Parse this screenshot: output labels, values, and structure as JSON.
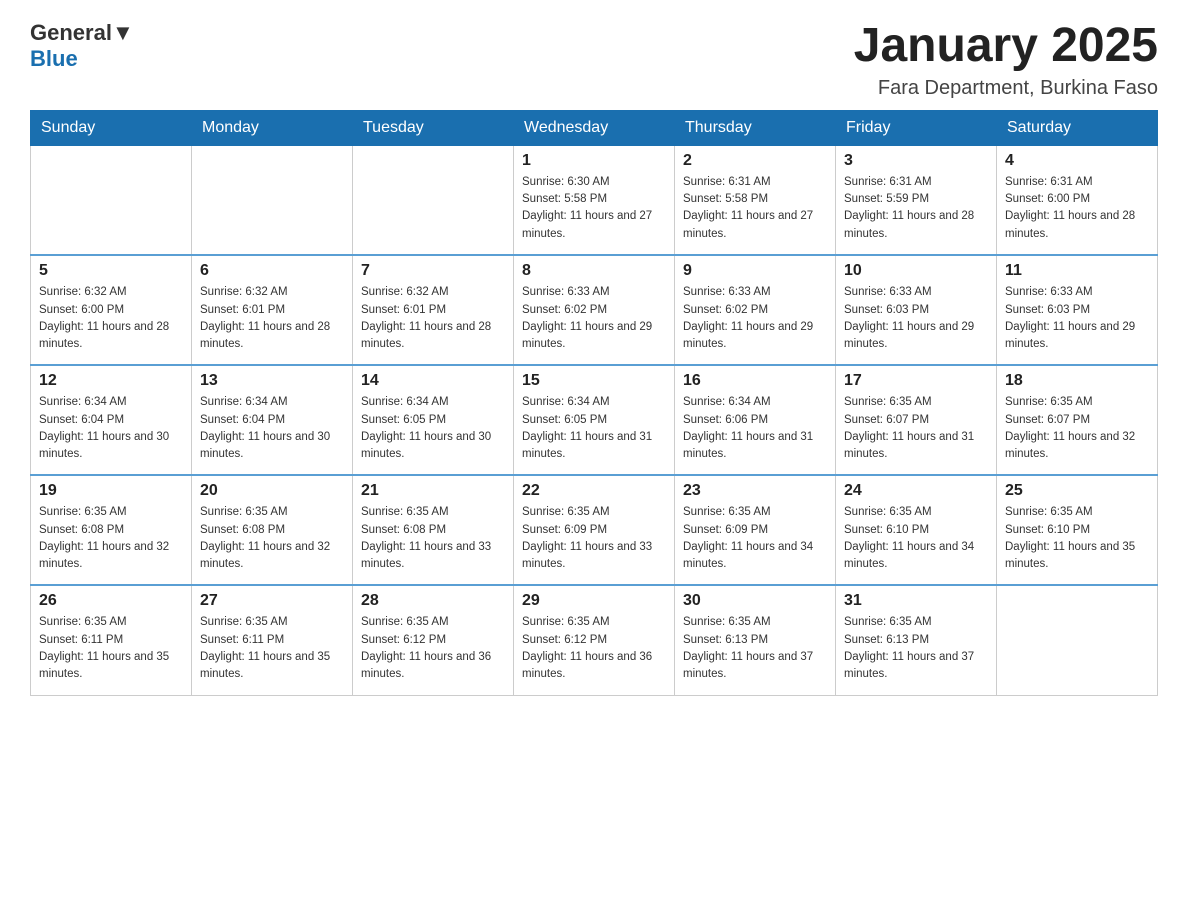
{
  "header": {
    "logo_text_general": "General",
    "logo_text_blue": "Blue",
    "title": "January 2025",
    "subtitle": "Fara Department, Burkina Faso"
  },
  "days_of_week": [
    "Sunday",
    "Monday",
    "Tuesday",
    "Wednesday",
    "Thursday",
    "Friday",
    "Saturday"
  ],
  "weeks": [
    {
      "days": [
        {
          "number": "",
          "info": ""
        },
        {
          "number": "",
          "info": ""
        },
        {
          "number": "",
          "info": ""
        },
        {
          "number": "1",
          "info": "Sunrise: 6:30 AM\nSunset: 5:58 PM\nDaylight: 11 hours and 27 minutes."
        },
        {
          "number": "2",
          "info": "Sunrise: 6:31 AM\nSunset: 5:58 PM\nDaylight: 11 hours and 27 minutes."
        },
        {
          "number": "3",
          "info": "Sunrise: 6:31 AM\nSunset: 5:59 PM\nDaylight: 11 hours and 28 minutes."
        },
        {
          "number": "4",
          "info": "Sunrise: 6:31 AM\nSunset: 6:00 PM\nDaylight: 11 hours and 28 minutes."
        }
      ]
    },
    {
      "days": [
        {
          "number": "5",
          "info": "Sunrise: 6:32 AM\nSunset: 6:00 PM\nDaylight: 11 hours and 28 minutes."
        },
        {
          "number": "6",
          "info": "Sunrise: 6:32 AM\nSunset: 6:01 PM\nDaylight: 11 hours and 28 minutes."
        },
        {
          "number": "7",
          "info": "Sunrise: 6:32 AM\nSunset: 6:01 PM\nDaylight: 11 hours and 28 minutes."
        },
        {
          "number": "8",
          "info": "Sunrise: 6:33 AM\nSunset: 6:02 PM\nDaylight: 11 hours and 29 minutes."
        },
        {
          "number": "9",
          "info": "Sunrise: 6:33 AM\nSunset: 6:02 PM\nDaylight: 11 hours and 29 minutes."
        },
        {
          "number": "10",
          "info": "Sunrise: 6:33 AM\nSunset: 6:03 PM\nDaylight: 11 hours and 29 minutes."
        },
        {
          "number": "11",
          "info": "Sunrise: 6:33 AM\nSunset: 6:03 PM\nDaylight: 11 hours and 29 minutes."
        }
      ]
    },
    {
      "days": [
        {
          "number": "12",
          "info": "Sunrise: 6:34 AM\nSunset: 6:04 PM\nDaylight: 11 hours and 30 minutes."
        },
        {
          "number": "13",
          "info": "Sunrise: 6:34 AM\nSunset: 6:04 PM\nDaylight: 11 hours and 30 minutes."
        },
        {
          "number": "14",
          "info": "Sunrise: 6:34 AM\nSunset: 6:05 PM\nDaylight: 11 hours and 30 minutes."
        },
        {
          "number": "15",
          "info": "Sunrise: 6:34 AM\nSunset: 6:05 PM\nDaylight: 11 hours and 31 minutes."
        },
        {
          "number": "16",
          "info": "Sunrise: 6:34 AM\nSunset: 6:06 PM\nDaylight: 11 hours and 31 minutes."
        },
        {
          "number": "17",
          "info": "Sunrise: 6:35 AM\nSunset: 6:07 PM\nDaylight: 11 hours and 31 minutes."
        },
        {
          "number": "18",
          "info": "Sunrise: 6:35 AM\nSunset: 6:07 PM\nDaylight: 11 hours and 32 minutes."
        }
      ]
    },
    {
      "days": [
        {
          "number": "19",
          "info": "Sunrise: 6:35 AM\nSunset: 6:08 PM\nDaylight: 11 hours and 32 minutes."
        },
        {
          "number": "20",
          "info": "Sunrise: 6:35 AM\nSunset: 6:08 PM\nDaylight: 11 hours and 32 minutes."
        },
        {
          "number": "21",
          "info": "Sunrise: 6:35 AM\nSunset: 6:08 PM\nDaylight: 11 hours and 33 minutes."
        },
        {
          "number": "22",
          "info": "Sunrise: 6:35 AM\nSunset: 6:09 PM\nDaylight: 11 hours and 33 minutes."
        },
        {
          "number": "23",
          "info": "Sunrise: 6:35 AM\nSunset: 6:09 PM\nDaylight: 11 hours and 34 minutes."
        },
        {
          "number": "24",
          "info": "Sunrise: 6:35 AM\nSunset: 6:10 PM\nDaylight: 11 hours and 34 minutes."
        },
        {
          "number": "25",
          "info": "Sunrise: 6:35 AM\nSunset: 6:10 PM\nDaylight: 11 hours and 35 minutes."
        }
      ]
    },
    {
      "days": [
        {
          "number": "26",
          "info": "Sunrise: 6:35 AM\nSunset: 6:11 PM\nDaylight: 11 hours and 35 minutes."
        },
        {
          "number": "27",
          "info": "Sunrise: 6:35 AM\nSunset: 6:11 PM\nDaylight: 11 hours and 35 minutes."
        },
        {
          "number": "28",
          "info": "Sunrise: 6:35 AM\nSunset: 6:12 PM\nDaylight: 11 hours and 36 minutes."
        },
        {
          "number": "29",
          "info": "Sunrise: 6:35 AM\nSunset: 6:12 PM\nDaylight: 11 hours and 36 minutes."
        },
        {
          "number": "30",
          "info": "Sunrise: 6:35 AM\nSunset: 6:13 PM\nDaylight: 11 hours and 37 minutes."
        },
        {
          "number": "31",
          "info": "Sunrise: 6:35 AM\nSunset: 6:13 PM\nDaylight: 11 hours and 37 minutes."
        },
        {
          "number": "",
          "info": ""
        }
      ]
    }
  ]
}
